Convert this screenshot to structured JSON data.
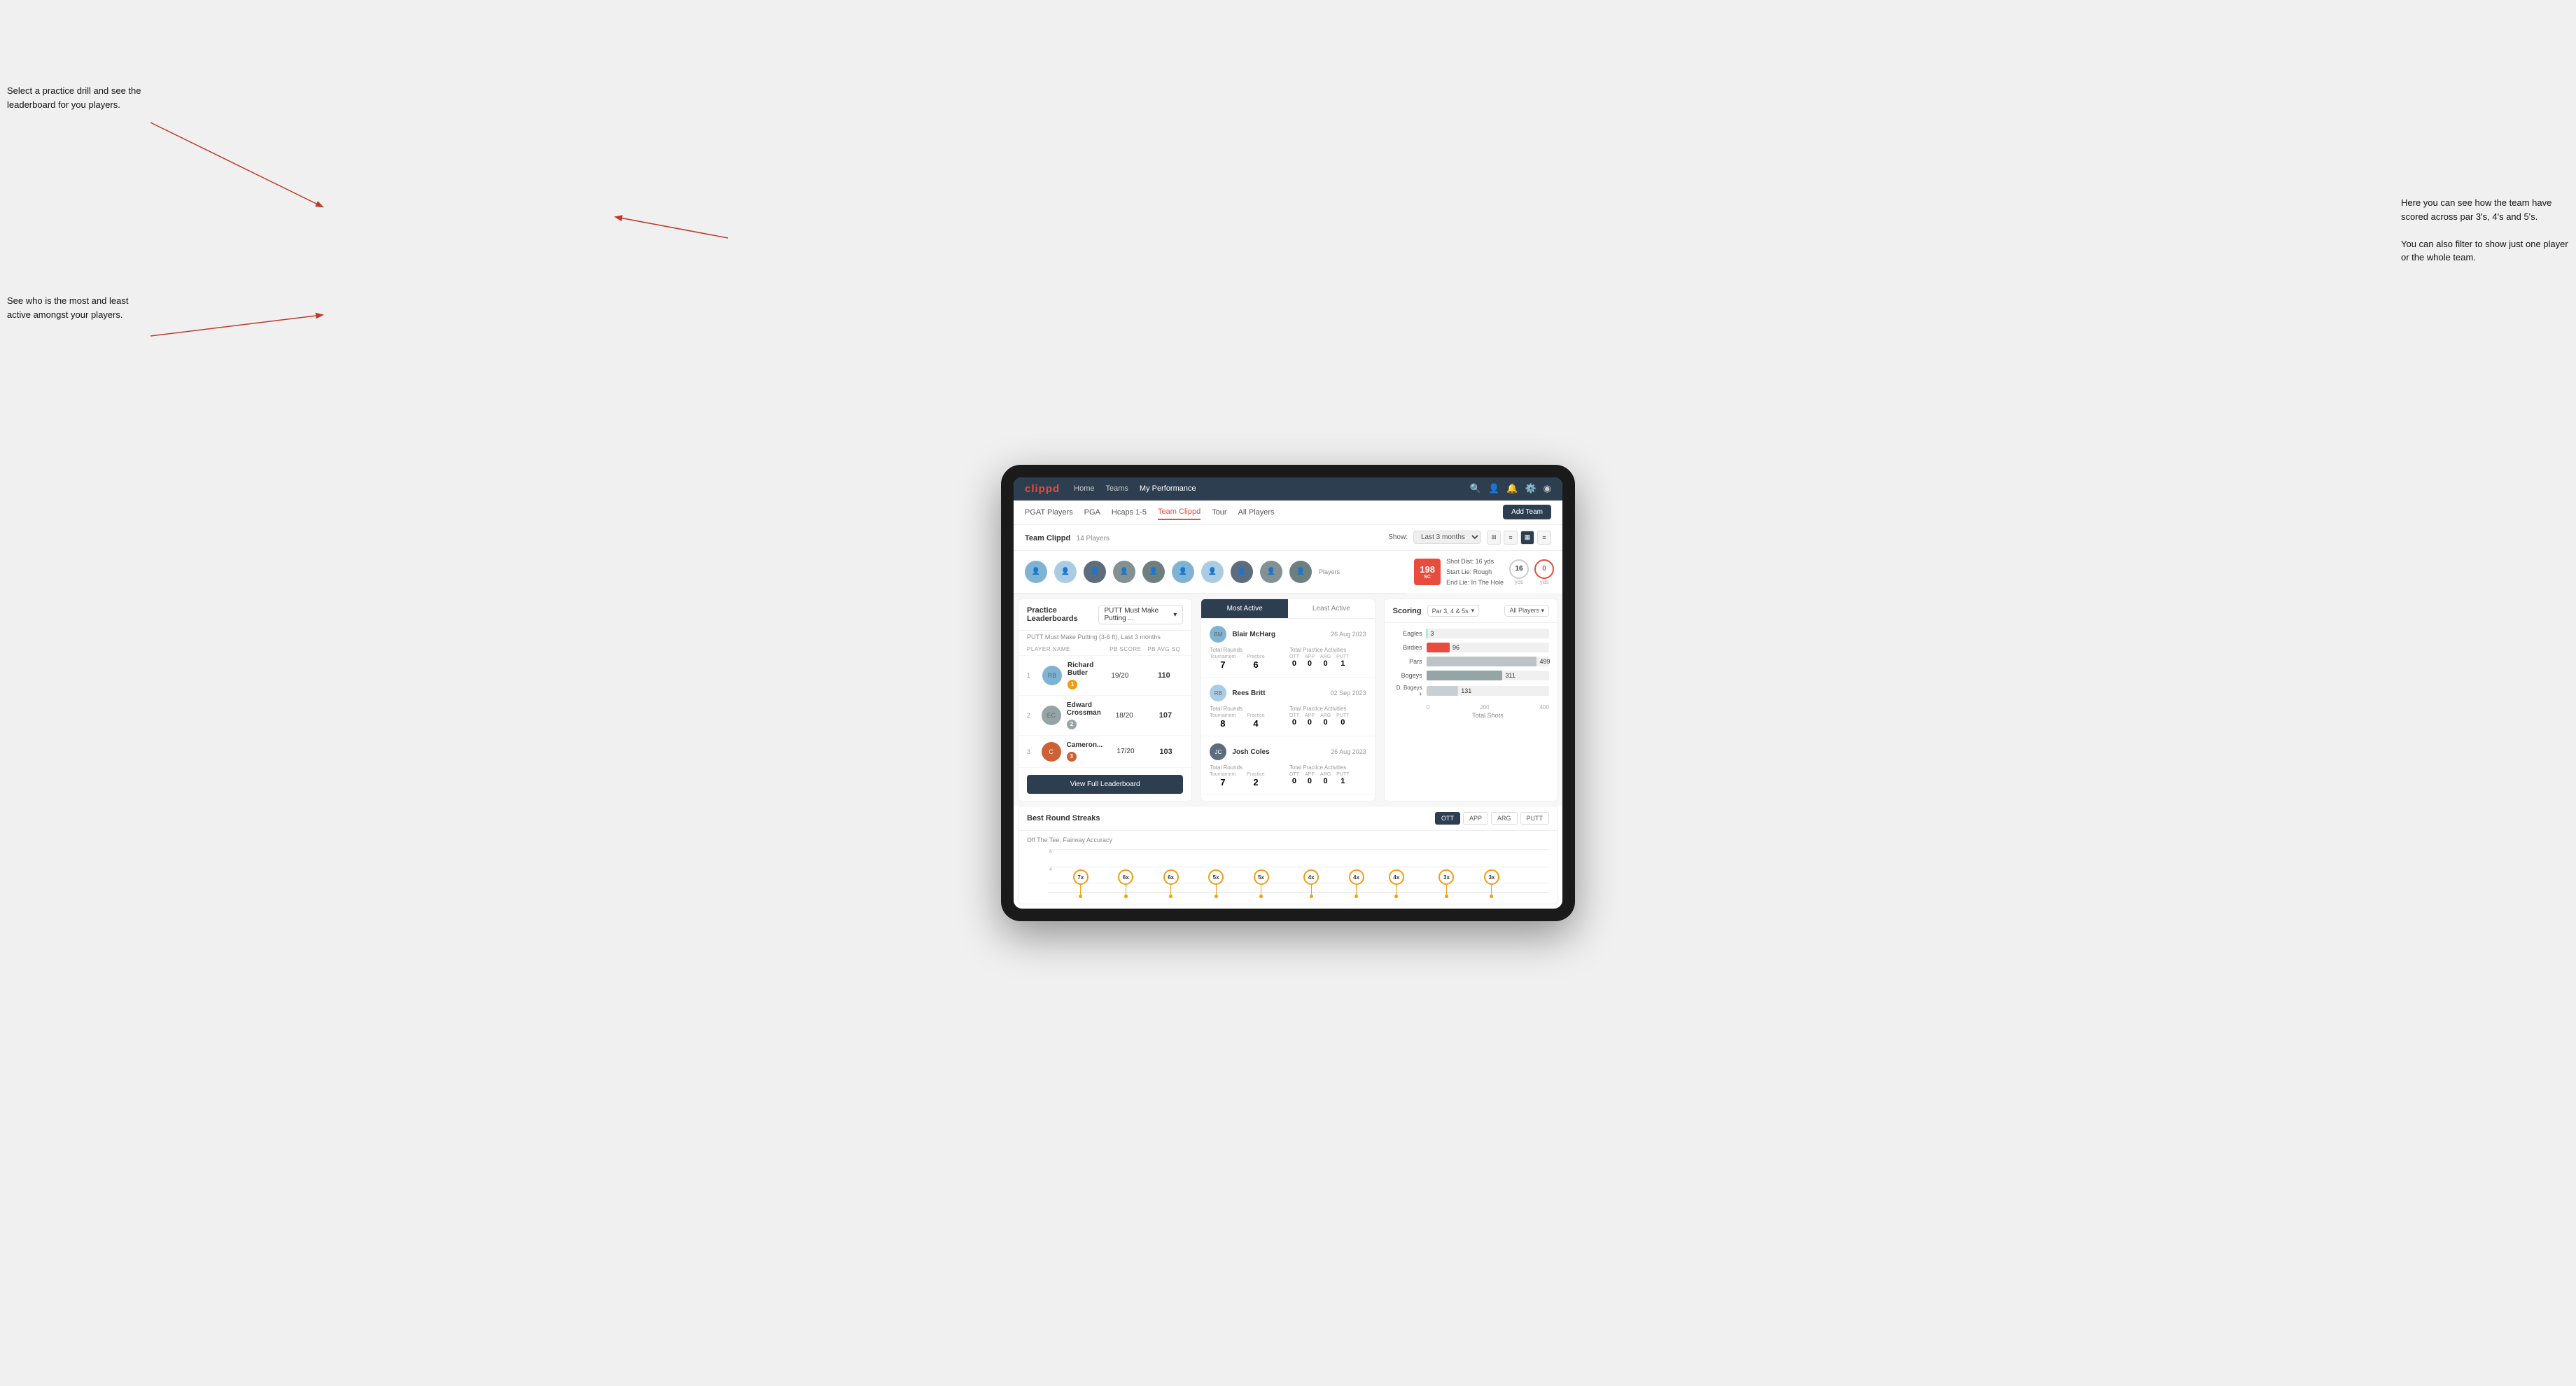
{
  "annotations": {
    "top_left": "Select a practice drill and see the leaderboard for you players.",
    "bottom_left": "See who is the most and least active amongst your players.",
    "top_right_title": "Here you can see how the team have scored across par 3's, 4's and 5's.",
    "top_right_body": "You can also filter to show just one player or the whole team."
  },
  "nav": {
    "logo": "clippd",
    "links": [
      "Home",
      "Teams",
      "My Performance"
    ],
    "icons": [
      "search",
      "person",
      "bell",
      "settings",
      "avatar"
    ]
  },
  "subnav": {
    "links": [
      "PGAT Players",
      "PGA",
      "Hcaps 1-5",
      "Team Clippd",
      "Tour",
      "All Players"
    ],
    "active": "Team Clippd",
    "add_button": "Add Team"
  },
  "team": {
    "name": "Team Clippd",
    "player_count": "14 Players",
    "show_label": "Show:",
    "show_value": "Last 3 months",
    "players_label": "Players"
  },
  "score_preview": {
    "badge": "198",
    "badge_sub": "SC",
    "details_line1": "Shot Dist: 16 yds",
    "details_line2": "Start Lie: Rough",
    "details_line3": "End Lie: In The Hole",
    "circle1": "16",
    "circle1_unit": "yds",
    "circle2": "0",
    "circle2_unit": "yds"
  },
  "leaderboard": {
    "title": "Practice Leaderboards",
    "dropdown": "PUTT Must Make Putting ...",
    "subtitle": "PUTT Must Make Putting (3-6 ft), Last 3 months",
    "col_player": "PLAYER NAME",
    "col_score": "PB SCORE",
    "col_avg": "PB AVG SQ",
    "players": [
      {
        "rank": 1,
        "name": "Richard Butler",
        "badge": "gold",
        "badge_num": "1",
        "score": "19/20",
        "avg": "110"
      },
      {
        "rank": 2,
        "name": "Edward Crossman",
        "badge": "silver",
        "badge_num": "2",
        "score": "18/20",
        "avg": "107"
      },
      {
        "rank": 3,
        "name": "Cameron...",
        "badge": "bronze",
        "badge_num": "3",
        "score": "17/20",
        "avg": "103"
      }
    ],
    "view_button": "View Full Leaderboard"
  },
  "activity": {
    "tabs": [
      "Most Active",
      "Least Active"
    ],
    "active_tab": "Most Active",
    "players": [
      {
        "name": "Blair McHarg",
        "date": "26 Aug 2023",
        "total_rounds_label": "Total Rounds",
        "tournament": "7",
        "practice": "6",
        "practice_activities_label": "Total Practice Activities",
        "ott": "0",
        "app": "0",
        "arg": "0",
        "putt": "1"
      },
      {
        "name": "Rees Britt",
        "date": "02 Sep 2023",
        "total_rounds_label": "Total Rounds",
        "tournament": "8",
        "practice": "4",
        "practice_activities_label": "Total Practice Activities",
        "ott": "0",
        "app": "0",
        "arg": "0",
        "putt": "0"
      },
      {
        "name": "Josh Coles",
        "date": "26 Aug 2023",
        "total_rounds_label": "Total Rounds",
        "tournament": "7",
        "practice": "2",
        "practice_activities_label": "Total Practice Activities",
        "ott": "0",
        "app": "0",
        "arg": "0",
        "putt": "1"
      }
    ]
  },
  "scoring": {
    "title": "Scoring",
    "filter": "Par 3, 4 & 5s",
    "player_filter": "All Players",
    "bars": [
      {
        "label": "Eagles",
        "value": 3,
        "max": 499,
        "color": "#2ecc71"
      },
      {
        "label": "Birdies",
        "value": 96,
        "max": 499,
        "color": "#e74c3c"
      },
      {
        "label": "Pars",
        "value": 499,
        "max": 499,
        "color": "#bdc3c7"
      },
      {
        "label": "Bogeys",
        "value": 311,
        "max": 499,
        "color": "#95a5a6"
      },
      {
        "label": "D. Bogeys +",
        "value": 131,
        "max": 499,
        "color": "#c8d0d5"
      }
    ],
    "x_labels": [
      "0",
      "200",
      "400"
    ],
    "x_title": "Total Shots"
  },
  "streaks": {
    "title": "Best Round Streaks",
    "subtitle": "Off The Tee, Fairway Accuracy",
    "filters": [
      "OTT",
      "APP",
      "ARG",
      "PUTT"
    ],
    "active_filter": "OTT",
    "pins": [
      {
        "value": "7x",
        "pos": 8
      },
      {
        "value": "6x",
        "pos": 16
      },
      {
        "value": "6x",
        "pos": 24
      },
      {
        "value": "5x",
        "pos": 33
      },
      {
        "value": "5x",
        "pos": 40
      },
      {
        "value": "4x",
        "pos": 50
      },
      {
        "value": "4x",
        "pos": 58
      },
      {
        "value": "4x",
        "pos": 65
      },
      {
        "value": "3x",
        "pos": 76
      },
      {
        "value": "3x",
        "pos": 84
      }
    ]
  }
}
